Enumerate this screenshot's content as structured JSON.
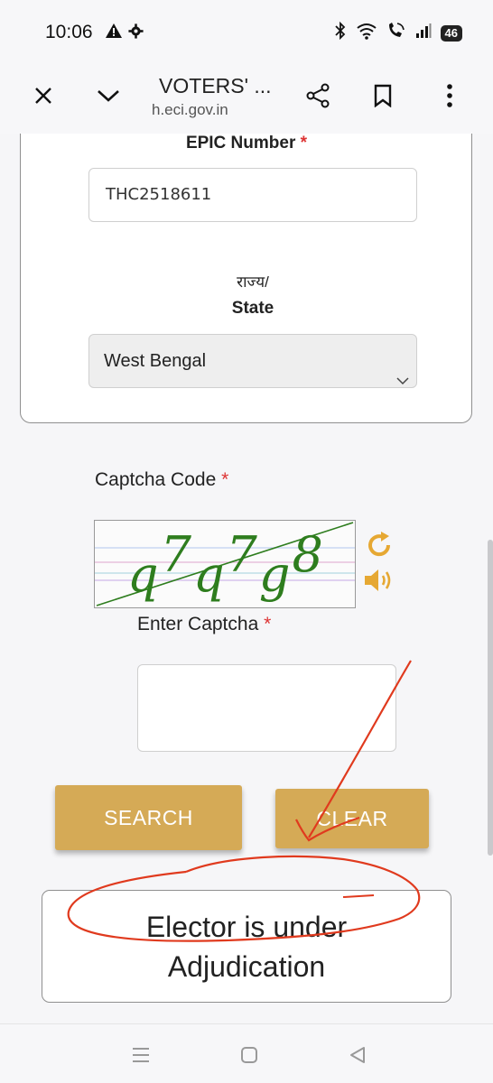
{
  "status_bar": {
    "time": "10:06",
    "battery": "46",
    "left_icons": [
      "warning-icon",
      "settings-icon"
    ],
    "right_icons": [
      "bluetooth-icon",
      "wifi-icon",
      "wifi-calling-icon",
      "signal-icon",
      "battery-icon"
    ]
  },
  "browser": {
    "title": "VOTERS' ...",
    "url": "h.eci.gov.in",
    "icons": [
      "close-icon",
      "chevron-down-icon",
      "share-icon",
      "bookmark-icon",
      "more-vert-icon"
    ]
  },
  "form": {
    "epic_label": "EPIC Number",
    "required_mark": "*",
    "epic_value": "THC2518611",
    "state_label_hindi": "राज्य/",
    "state_label": "State",
    "state_selected": "West Bengal",
    "captcha_label": "Captcha Code",
    "captcha_text": "q7q7g8",
    "enter_captcha_label": "Enter Captcha",
    "enter_captcha_value": "",
    "search_button": "SEARCH",
    "clear_button": "CLEAR"
  },
  "result": {
    "line1": "Elector is under",
    "line2": "Adjudication"
  },
  "colors": {
    "accent_button": "#d5aa56",
    "required": "#dd3333",
    "captcha_text": "#2e7d1e",
    "captcha_icon": "#e6a833",
    "annotation": "#e03a1e"
  },
  "nav": {
    "icons": [
      "menu-icon",
      "home-icon",
      "back-icon"
    ]
  }
}
